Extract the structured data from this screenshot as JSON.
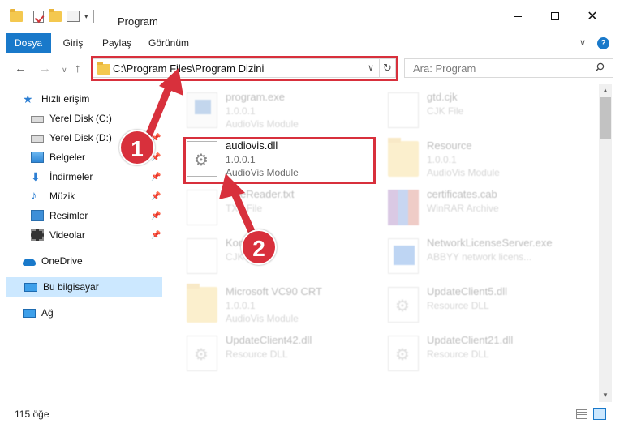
{
  "window": {
    "title": "Program"
  },
  "ribbon": {
    "tabs": [
      "Dosya",
      "Giriş",
      "Paylaş",
      "Görünüm"
    ]
  },
  "address": {
    "path": "C:\\Program Files\\Program Dizini",
    "search_placeholder": "Ara: Program"
  },
  "sidebar": {
    "items": [
      {
        "label": "Hızlı erişim",
        "icon": "star-icon"
      },
      {
        "label": "Yerel Disk (C:)",
        "icon": "drive-icon"
      },
      {
        "label": "Yerel Disk (D:)",
        "icon": "drive-icon"
      },
      {
        "label": "Belgeler",
        "icon": "documents-icon"
      },
      {
        "label": "İndirmeler",
        "icon": "download-icon"
      },
      {
        "label": "Müzik",
        "icon": "music-icon"
      },
      {
        "label": "Resimler",
        "icon": "pictures-icon"
      },
      {
        "label": "Videolar",
        "icon": "videos-icon"
      },
      {
        "label": "OneDrive",
        "icon": "cloud-icon"
      },
      {
        "label": "Bu bilgisayar",
        "icon": "computer-icon"
      },
      {
        "label": "Ağ",
        "icon": "network-icon"
      }
    ]
  },
  "files": [
    {
      "name": "program.exe",
      "l1": "1.0.0.1",
      "l2": "AudioVis Module"
    },
    {
      "name": "gtd.cjk",
      "l1": "CJK File",
      "l2": ""
    },
    {
      "name": "audiovis.dll",
      "l1": "1.0.0.1",
      "l2": "AudioVis Module"
    },
    {
      "name": "Resource",
      "l1": "1.0.0.1",
      "l2": "AudioVis Module"
    },
    {
      "name": "FineReader.txt",
      "l1": "TXT File",
      "l2": ""
    },
    {
      "name": "certificates.cab",
      "l1": "WinRAR Archive",
      "l2": ""
    },
    {
      "name": "Korean",
      "l1": "CJK File",
      "l2": ""
    },
    {
      "name": "NetworkLicenseServer.exe",
      "l1": "ABBYY network licens...",
      "l2": ""
    },
    {
      "name": "Microsoft VC90 CRT",
      "l1": "1.0.0.1",
      "l2": "AudioVis Module"
    },
    {
      "name": "UpdateClient5.dll",
      "l1": "Resource DLL",
      "l2": ""
    },
    {
      "name": "UpdateClient42.dll",
      "l1": "Resource DLL",
      "l2": ""
    },
    {
      "name": "UpdateClient21.dll",
      "l1": "Resource DLL",
      "l2": ""
    }
  ],
  "status": {
    "count": "115 öğe"
  },
  "annotations": {
    "badge1": "1",
    "badge2": "2"
  },
  "colors": {
    "accent": "#1979ca",
    "highlight": "#d8303c",
    "selected": "#cce8ff"
  }
}
